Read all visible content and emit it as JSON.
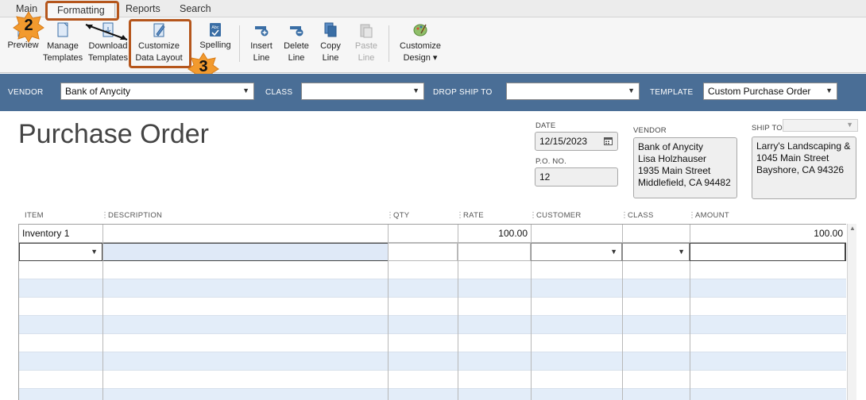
{
  "tabs": [
    "Main",
    "Formatting",
    "Reports",
    "Search"
  ],
  "ribbon": {
    "preview": "Preview",
    "manage_templates": [
      "Manage",
      "Templates"
    ],
    "download_templates": [
      "Download",
      "Templates"
    ],
    "customize_data_layout": [
      "Customize",
      "Data Layout"
    ],
    "spelling": "Spelling",
    "insert_line": [
      "Insert",
      "Line"
    ],
    "delete_line": [
      "Delete",
      "Line"
    ],
    "copy_line": [
      "Copy",
      "Line"
    ],
    "paste_line": [
      "Paste",
      "Line"
    ],
    "customize_design": [
      "Customize",
      "Design ▾"
    ]
  },
  "callouts": [
    "2",
    "3"
  ],
  "header": {
    "vendor_label": "VENDOR",
    "vendor_value": "Bank of Anycity",
    "class_label": "CLASS",
    "class_value": "",
    "drop_ship_label": "DROP SHIP TO",
    "drop_ship_value": "",
    "template_label": "TEMPLATE",
    "template_value": "Custom Purchase Order"
  },
  "form": {
    "title": "Purchase Order",
    "date_label": "DATE",
    "date_value": "12/15/2023",
    "po_label": "P.O. NO.",
    "po_value": "12",
    "vendor_label": "VENDOR",
    "vendor_address": [
      "Bank of Anycity",
      "Lisa Holzhauser",
      "1935 Main Street",
      "Middlefield, CA 94482"
    ],
    "ship_to_label": "SHIP TO",
    "ship_to_address": [
      "Larry's Landscaping &",
      "1045 Main Street",
      "Bayshore, CA 94326"
    ]
  },
  "grid": {
    "columns": [
      "ITEM",
      "DESCRIPTION",
      "QTY",
      "RATE",
      "CUSTOMER",
      "CLASS",
      "AMOUNT"
    ],
    "rows": [
      {
        "item": "Inventory 1",
        "description": "",
        "qty": "",
        "rate": "100.00",
        "customer": "",
        "class": "",
        "amount": "100.00"
      }
    ]
  },
  "colors": {
    "header_bar": "#4a6e96",
    "callout_orange": "#f29a2e",
    "callout_outline": "#b5561c",
    "row_stripe": "#e3edf9"
  }
}
